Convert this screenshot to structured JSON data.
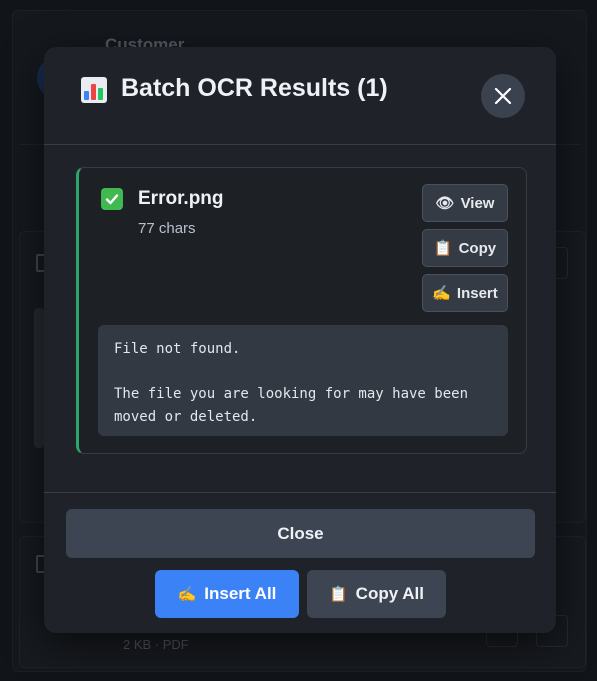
{
  "background": {
    "customer_label": "Customer",
    "file_meta": "2 KB · PDF"
  },
  "modal": {
    "title": "Batch OCR Results (1)",
    "title_icon": "bar-chart-icon",
    "close_icon": "close-icon"
  },
  "results": [
    {
      "status_icon": "check-icon",
      "file_name": "Error.png",
      "chars": "77 chars",
      "actions": {
        "view": "View",
        "copy": "Copy",
        "insert": "Insert"
      },
      "text": "File not found.\n\nThe file you are looking for may have been\nmoved or deleted."
    }
  ],
  "footer": {
    "close_label": "Close",
    "insert_all_label": "Insert All",
    "copy_all_label": "Copy All"
  },
  "colors": {
    "accent_blue": "#3b82f6",
    "success_green": "#2ea46b",
    "modal_bg": "#1f2329"
  }
}
